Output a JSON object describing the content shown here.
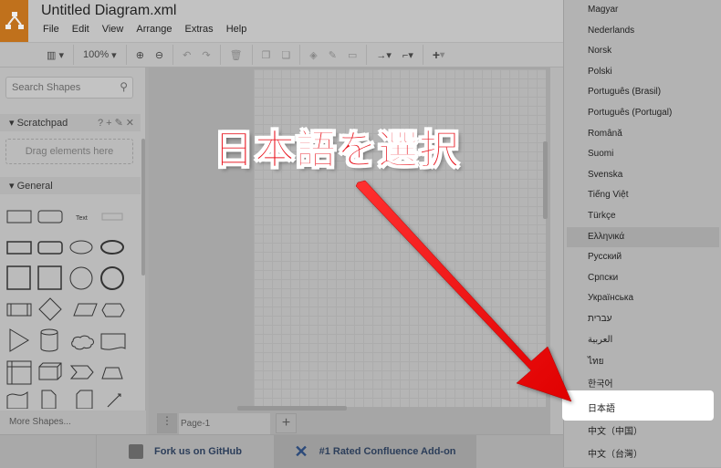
{
  "app": {
    "title": "Untitled Diagram.xml",
    "menu": [
      "File",
      "Edit",
      "View",
      "Arrange",
      "Extras",
      "Help"
    ],
    "accent": "#c0711c"
  },
  "toolbar": {
    "zoom": "100%"
  },
  "sidebar": {
    "search_placeholder": "Search Shapes",
    "scratchpad": "Scratchpad",
    "scratch_actions": [
      "?",
      "+",
      "✎",
      "✕"
    ],
    "drag_hint": "Drag elements here",
    "general": "General",
    "text_shape": "Text",
    "more_shapes": "More Shapes..."
  },
  "pages": {
    "tab": "Page-1",
    "add": "+",
    "menu": "⋮"
  },
  "footer": {
    "github": "Fork us on GitHub",
    "confluence": "#1 Rated Confluence Add-on"
  },
  "language_menu": {
    "items": [
      "Magyar",
      "Nederlands",
      "Norsk",
      "Polski",
      "Português (Brasil)",
      "Português (Portugal)",
      "Română",
      "Suomi",
      "Svenska",
      "Tiếng Việt",
      "Türkçe",
      "Ελληνικά",
      "Русский",
      "Српски",
      "Українська",
      "עברית",
      "العربية",
      "ไทย",
      "한국어",
      "日本語",
      "中文（中国）",
      "中文（台灣）"
    ],
    "hovered": "Ελληνικά",
    "highlighted": "日本語"
  },
  "annotation": {
    "text": "日本語を選択",
    "color": "#e8141e"
  }
}
